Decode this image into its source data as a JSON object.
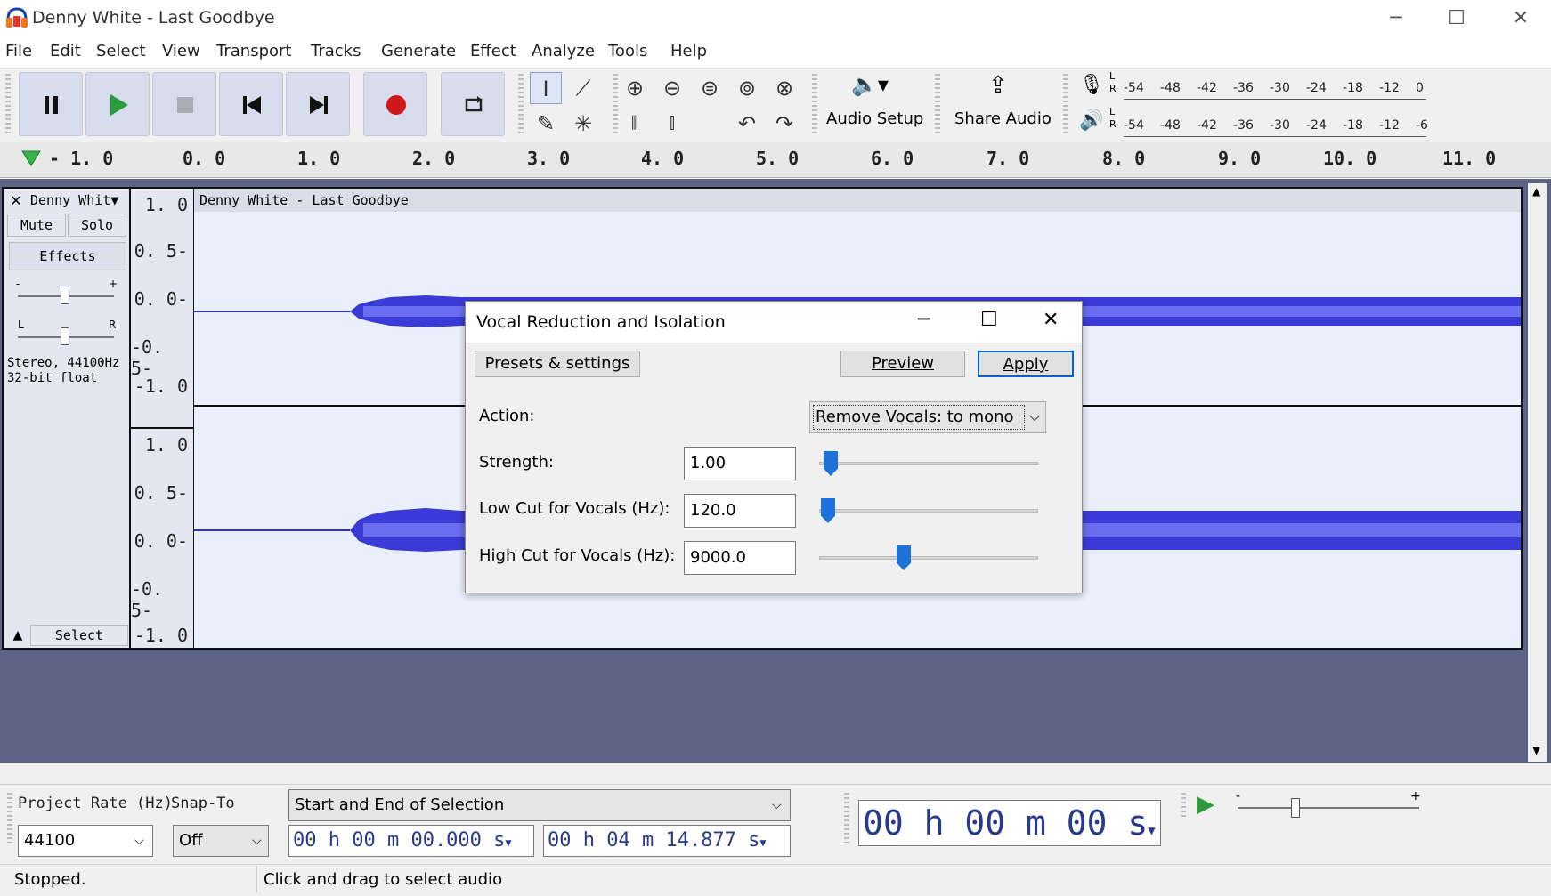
{
  "window": {
    "title": "Denny White - Last Goodbye"
  },
  "menu": [
    "File",
    "Edit",
    "Select",
    "View",
    "Transport",
    "Tracks",
    "Generate",
    "Effect",
    "Analyze",
    "Tools",
    "Help"
  ],
  "toolbar": {
    "audio_setup": "Audio Setup",
    "share_audio": "Share Audio"
  },
  "meters": {
    "record": [
      "-54",
      "-48",
      "-42",
      "-36",
      "-30",
      "-24",
      "-18",
      "-12",
      "0"
    ],
    "play": [
      "-54",
      "-48",
      "-42",
      "-36",
      "-30",
      "-24",
      "-18",
      "-12",
      "-6"
    ],
    "lr_top": "L",
    "lr_bottom": "R"
  },
  "ruler": {
    "labels": [
      "- 1. 0",
      "0. 0",
      "1. 0",
      "2. 0",
      "3. 0",
      "4. 0",
      "5. 0",
      "6. 0",
      "7. 0",
      "8. 0",
      "9. 0",
      "10. 0",
      "11. 0"
    ]
  },
  "track": {
    "name": "Denny Whit",
    "clip_title": "Denny White - Last Goodbye",
    "mute": "Mute",
    "solo": "Solo",
    "effects": "Effects",
    "gain_minus": "-",
    "gain_plus": "+",
    "pan_left": "L",
    "pan_right": "R",
    "info1": "Stereo, 44100Hz",
    "info2": "32-bit float",
    "select": "Select",
    "vruler": [
      "1. 0",
      "0. 5-",
      "0. 0-",
      "-0. 5-",
      "-1. 0"
    ]
  },
  "dialog": {
    "title": "Vocal Reduction and Isolation",
    "presets": "Presets & settings",
    "preview": "Preview",
    "apply": "Apply",
    "action_label": "Action:",
    "action_value": "Remove Vocals: to mono",
    "strength_label": "Strength:",
    "strength_value": "1.00",
    "lowcut_label": "Low Cut for Vocals (Hz):",
    "lowcut_value": "120.0",
    "highcut_label": "High Cut for Vocals (Hz):",
    "highcut_value": "9000.0"
  },
  "bottom": {
    "project_rate_label": "Project Rate (Hz)",
    "project_rate_value": "44100",
    "snap_label": "Snap-To",
    "snap_value": "Off",
    "selection_mode": "Start and End of Selection",
    "sel_start": "00 h 00 m 00.000 s",
    "sel_end": "00 h 04 m 14.877 s",
    "big_time": "00 h 00 m 00 s",
    "play_minus": "-",
    "play_plus": "+",
    "status": "Stopped.",
    "hint": "Click and drag to select audio"
  }
}
